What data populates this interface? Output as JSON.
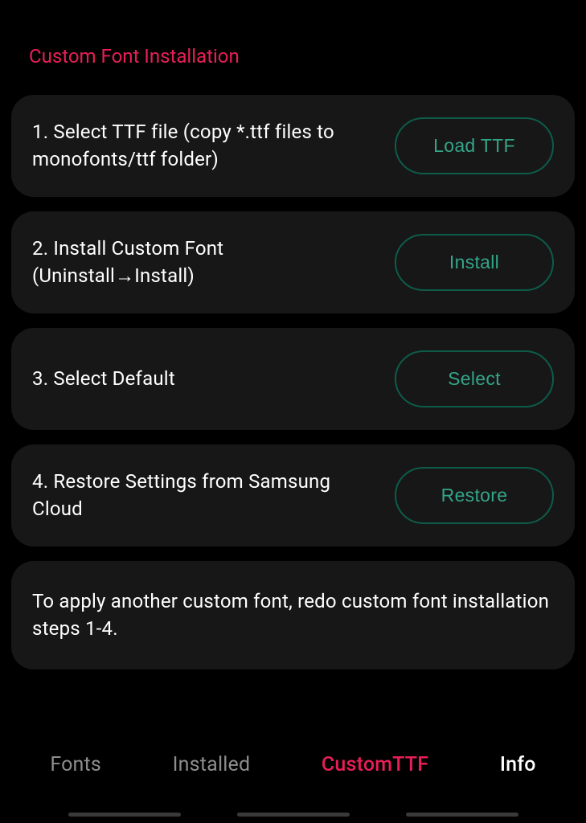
{
  "section_title": "Custom Font Installation",
  "steps": [
    {
      "text": "1. Select TTF file (copy *.ttf files to monofonts/ttf folder)",
      "button": "Load TTF"
    },
    {
      "text": "2. Install Custom Font (Uninstall→Install)",
      "button": "Install"
    },
    {
      "text": "3. Select Default",
      "button": "Select"
    },
    {
      "text": "4. Restore Settings from Samsung Cloud",
      "button": "Restore"
    }
  ],
  "info_text": "To apply another custom font, redo custom font installation steps 1-4.",
  "nav": {
    "fonts": "Fonts",
    "installed": "Installed",
    "customttf": "CustomTTF",
    "info": "Info"
  }
}
